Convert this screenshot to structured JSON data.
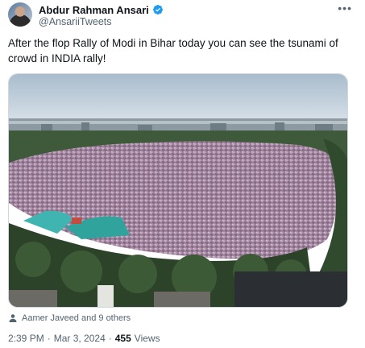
{
  "author": {
    "name": "Abdur Rahman Ansari",
    "handle": "@AnsariiTweets",
    "verified": true,
    "verified_color": "#1d9bf0"
  },
  "menu_icon": "more-horizontal-icon",
  "tweet": {
    "text": "After the flop Rally of Modi in Bihar today you can see the tsunami of crowd in INDIA rally!"
  },
  "media": {
    "type": "photo",
    "icon": "crowd-rally-photo"
  },
  "tagged": {
    "icon": "person-icon",
    "text": "Aamer Javeed and 9 others"
  },
  "meta": {
    "time": "2:39 PM",
    "separator": "·",
    "date": "Mar 3, 2024",
    "views_count": "455",
    "views_label": "Views"
  },
  "colors": {
    "text": "#0f1419",
    "secondary": "#536471",
    "border": "#cfd9de"
  }
}
